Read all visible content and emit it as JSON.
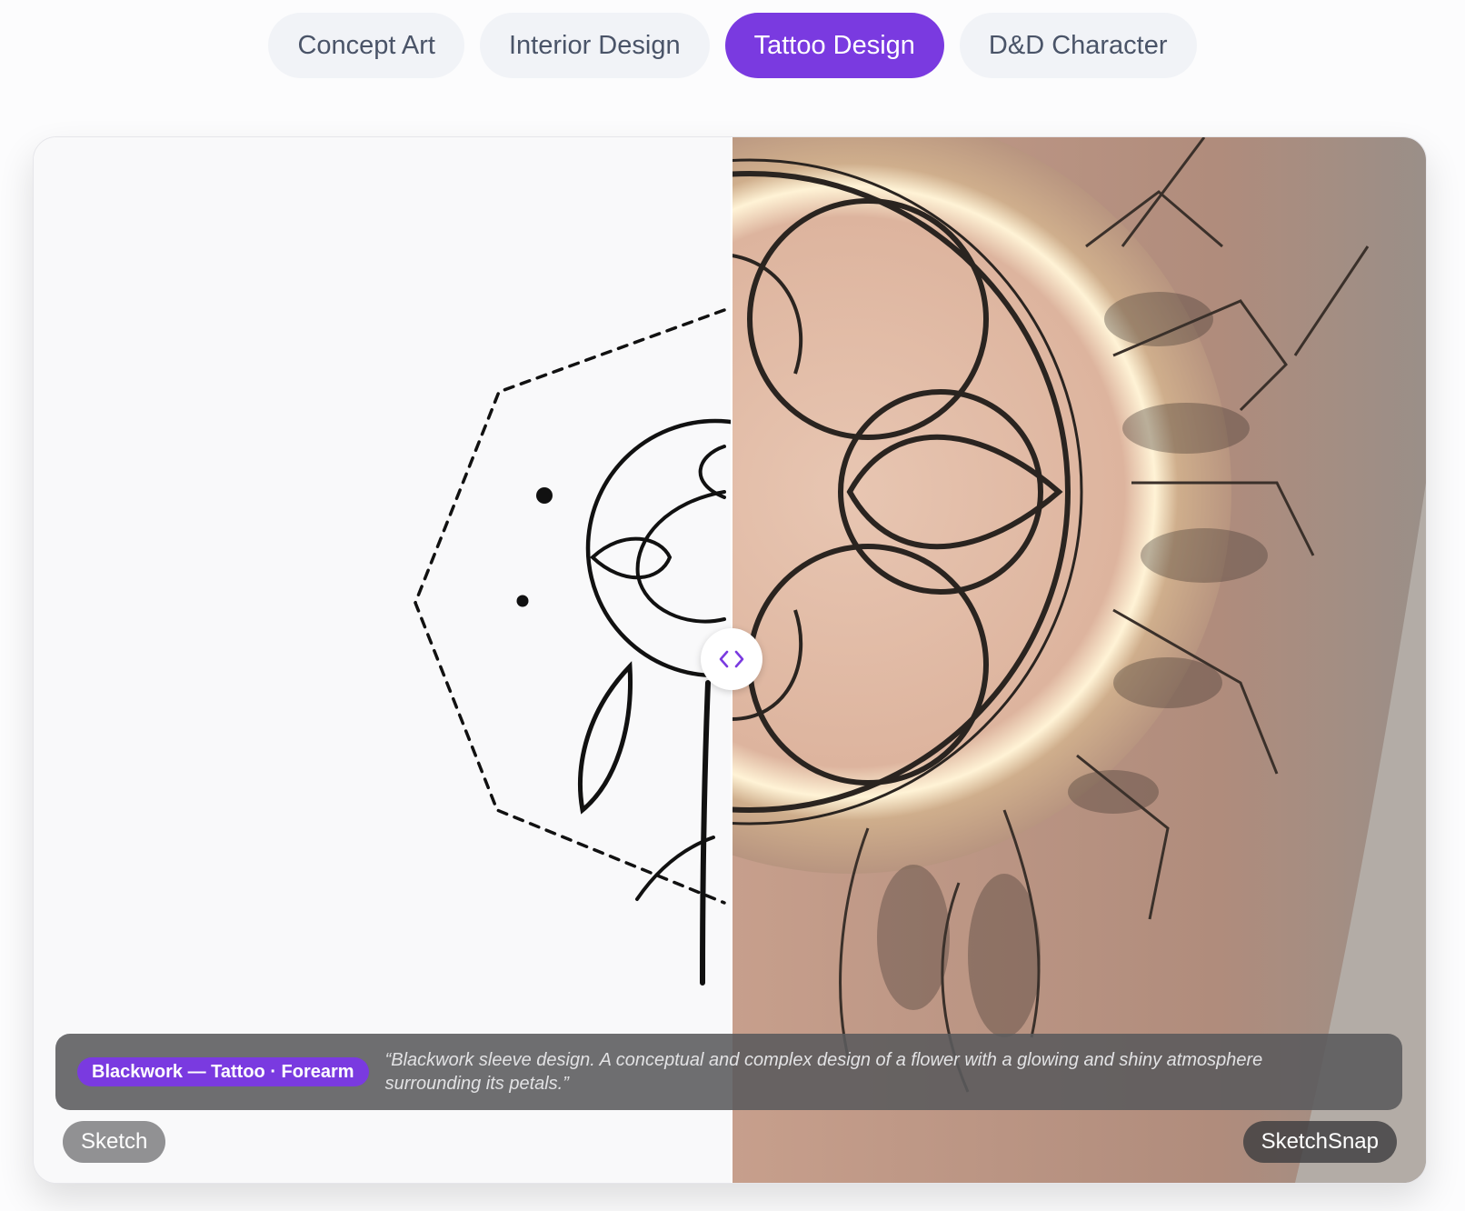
{
  "tabs": [
    {
      "label": "Concept Art",
      "active": false
    },
    {
      "label": "Interior Design",
      "active": false
    },
    {
      "label": "Tattoo Design",
      "active": true
    },
    {
      "label": "D&D Character",
      "active": false
    }
  ],
  "comparison": {
    "caption_badge": "Blackwork — Tattoo · Forearm",
    "caption_prompt": "“Blackwork sleeve design. A conceptual and complex design of a flower with a glowing and shiny atmosphere surrounding its petals.”",
    "left_label": "Sketch",
    "right_label": "SketchSnap",
    "handle_icon": "chevron-left-right-icon"
  },
  "colors": {
    "accent": "#7a3ae0",
    "tab_bg": "#f1f3f7",
    "tab_text": "#4a5468"
  }
}
